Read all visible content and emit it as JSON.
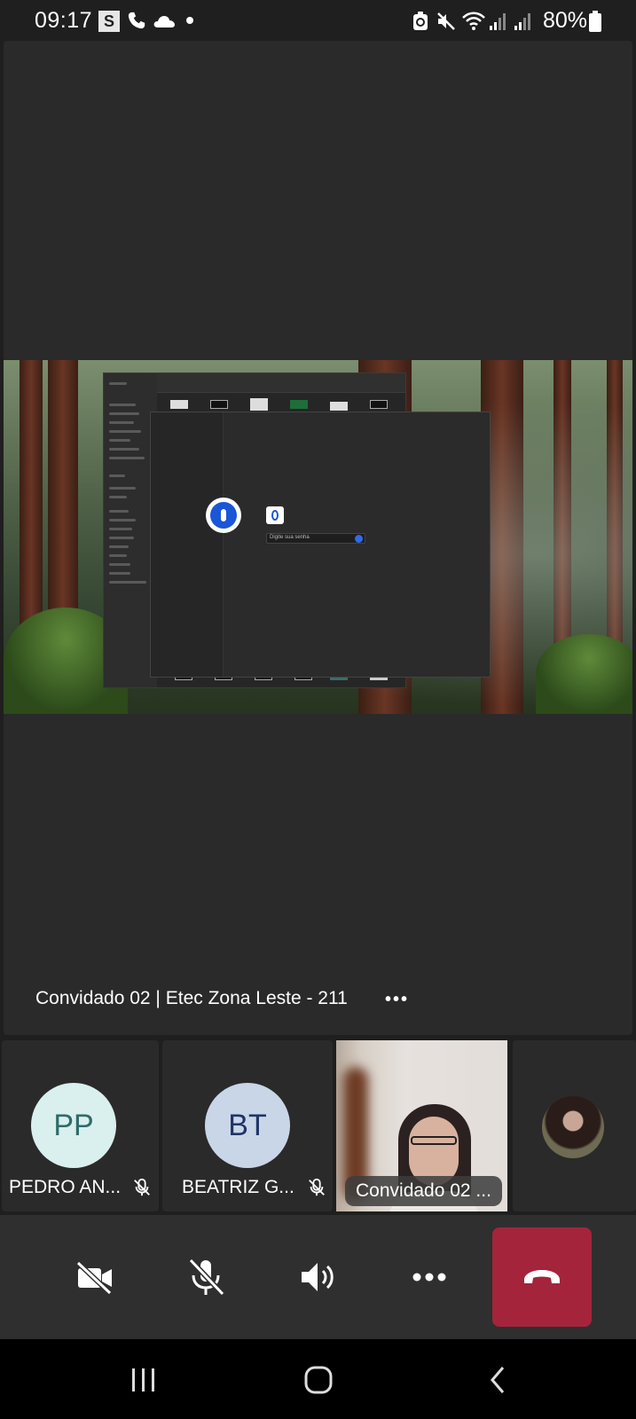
{
  "status_bar": {
    "time": "09:17",
    "s_badge": "S",
    "battery": "80%",
    "icons": [
      "s-app-icon",
      "phone-icon",
      "cloud-icon",
      "dot-icon",
      "recycle-icon",
      "mute-icon",
      "wifi-icon",
      "signal-icon",
      "signal-icon",
      "battery-icon"
    ]
  },
  "stage": {
    "caption": "Convidado 02 | Etec Zona Leste - 211",
    "more_label": "•••",
    "shared_screen": {
      "password_placeholder": "Digite sua senha"
    }
  },
  "participants": [
    {
      "initials": "PP",
      "name": "PEDRO AN...",
      "muted": true,
      "avatar_bg": "#d9f0ee",
      "avatar_fg": "#2f6b6a"
    },
    {
      "initials": "BT",
      "name": "BEATRIZ G...",
      "muted": true,
      "avatar_bg": "#c9d6e8",
      "avatar_fg": "#1e3566"
    },
    {
      "name": "Convidado 02 ...",
      "video": true
    }
  ],
  "controls": {
    "camera": "camera-off-icon",
    "mic": "mic-off-icon",
    "speaker": "speaker-icon",
    "more": "more-icon",
    "hangup": "hangup-icon",
    "hangup_color": "#a4243b"
  },
  "nav": [
    "recents-icon",
    "home-icon",
    "back-icon"
  ]
}
